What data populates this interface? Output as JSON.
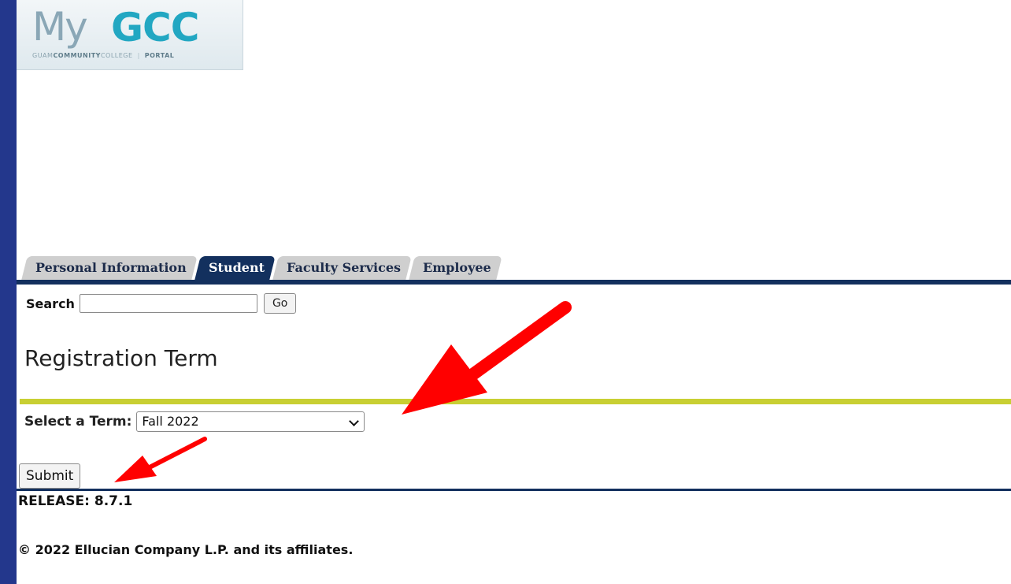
{
  "logo": {
    "my": "My",
    "gcc": "GCC",
    "tagline_part1": "GUAM",
    "tagline_part2": "COMMUNITY",
    "tagline_part3": "COLLEGE",
    "tagline_part4": "PORTAL"
  },
  "tabs": [
    {
      "label": "Personal Information",
      "active": false
    },
    {
      "label": "Student",
      "active": true
    },
    {
      "label": "Faculty Services",
      "active": false
    },
    {
      "label": "Employee",
      "active": false
    }
  ],
  "search": {
    "label": "Search",
    "value": "",
    "button": "Go"
  },
  "page_title": "Registration Term",
  "term": {
    "label": "Select a Term:",
    "selected": "Fall 2022"
  },
  "submit_label": "Submit",
  "release": "RELEASE: 8.7.1",
  "copyright": "© 2022 Ellucian Company L.P. and its affiliates.",
  "colors": {
    "frame": "#23378c",
    "tab_active": "#13305e",
    "accent_rule": "#c8cf33",
    "arrow": "#ff0000"
  }
}
